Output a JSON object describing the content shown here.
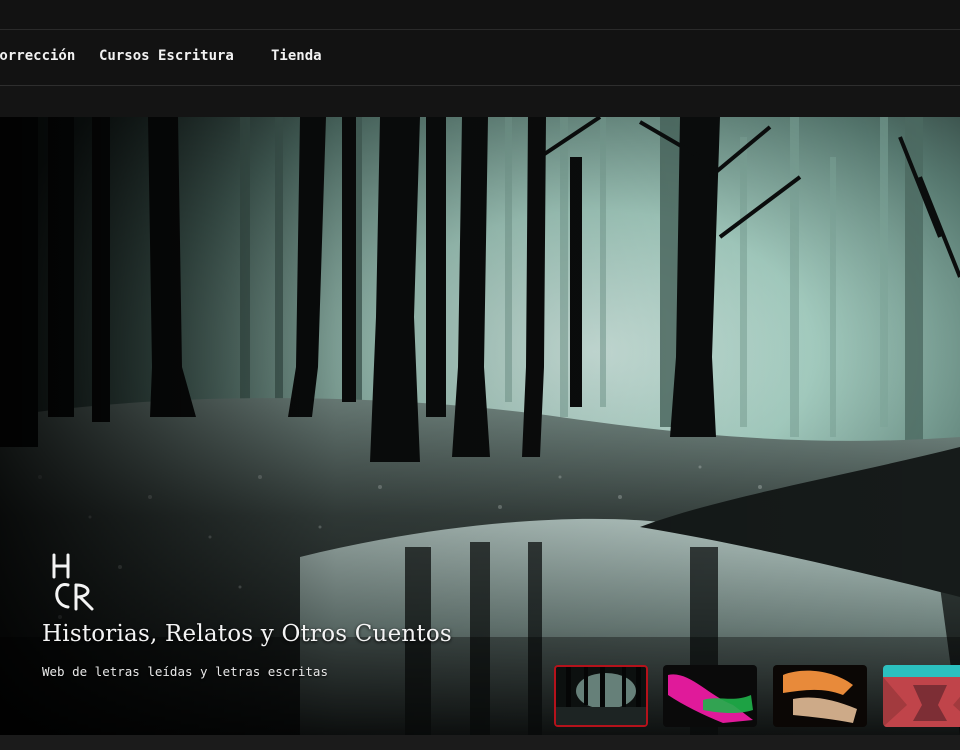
{
  "nav": {
    "items": [
      {
        "label": "Corrección",
        "name": "nav-item-correccion"
      },
      {
        "label": "Cursos Escritura",
        "name": "nav-item-cursos-escritura"
      },
      {
        "label": "Tienda",
        "name": "nav-item-tienda"
      }
    ]
  },
  "hero": {
    "logo_text": "HCR",
    "title": "Historias, Relatos y Otros Cuentos",
    "tagline": "Web de letras leídas y letras escritas"
  },
  "slider": {
    "active_index": 0,
    "thumbnails": [
      {
        "name": "thumbnail-forest"
      },
      {
        "name": "thumbnail-pink"
      },
      {
        "name": "thumbnail-orange"
      },
      {
        "name": "thumbnail-red"
      }
    ]
  },
  "colors": {
    "background": "#151515",
    "accent_border": "#b5121b",
    "fog": "#bfe3d8"
  }
}
